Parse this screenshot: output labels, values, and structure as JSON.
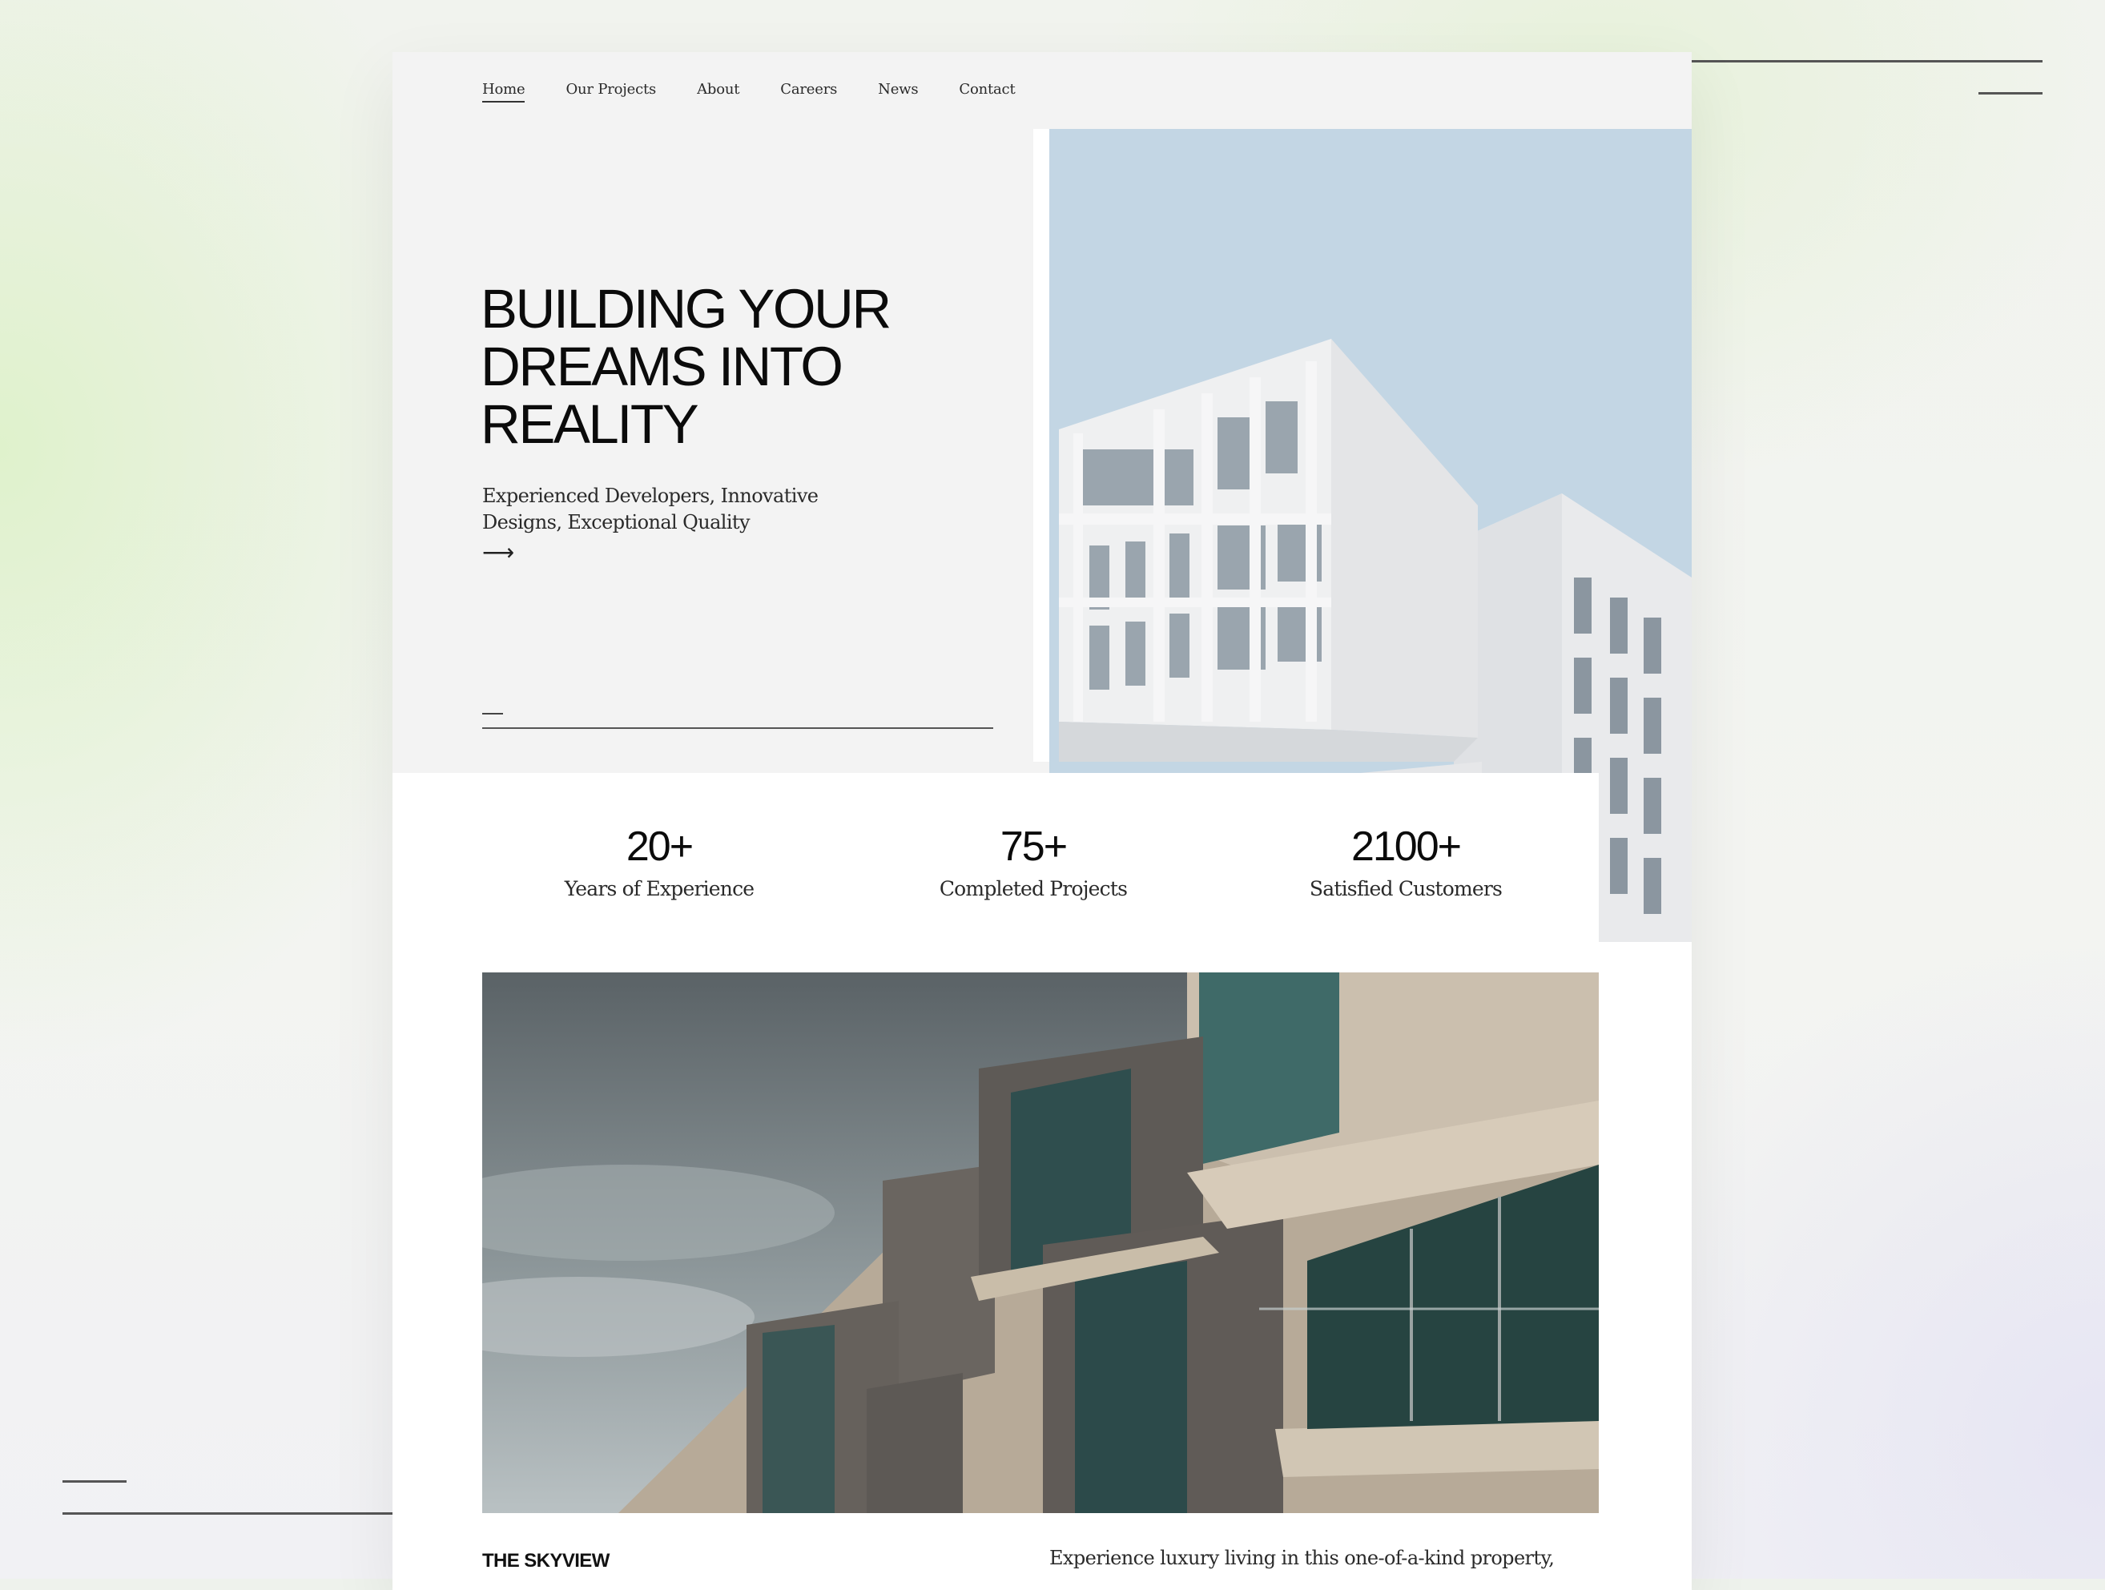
{
  "nav": {
    "items": [
      {
        "label": "Home",
        "active": true
      },
      {
        "label": "Our Projects",
        "active": false
      },
      {
        "label": "About",
        "active": false
      },
      {
        "label": "Careers",
        "active": false
      },
      {
        "label": "News",
        "active": false
      },
      {
        "label": "Contact",
        "active": false
      }
    ]
  },
  "hero": {
    "title_lines": [
      "BUILDING YOUR",
      "DREAMS INTO",
      "REALITY"
    ],
    "subtitle_lines": [
      "Experienced Developers, Innovative",
      "Designs, Exceptional Quality"
    ],
    "arrow": "⟶",
    "arrow_icon": "arrow-right-icon"
  },
  "stats": [
    {
      "value": "20+",
      "label": "Years of Experience"
    },
    {
      "value": "75+",
      "label": "Completed Projects"
    },
    {
      "value": "2100+",
      "label": "Satisfied Customers"
    }
  ],
  "project": {
    "name": "THE SKYVIEW",
    "description": "Experience luxury living in this one-of-a-kind property,"
  },
  "colors": {
    "hero_panel": "#f3f3f3",
    "sky": "#c2d5e3",
    "text": "#0b0b0b",
    "accent_green_glow": "#dff2cc"
  }
}
